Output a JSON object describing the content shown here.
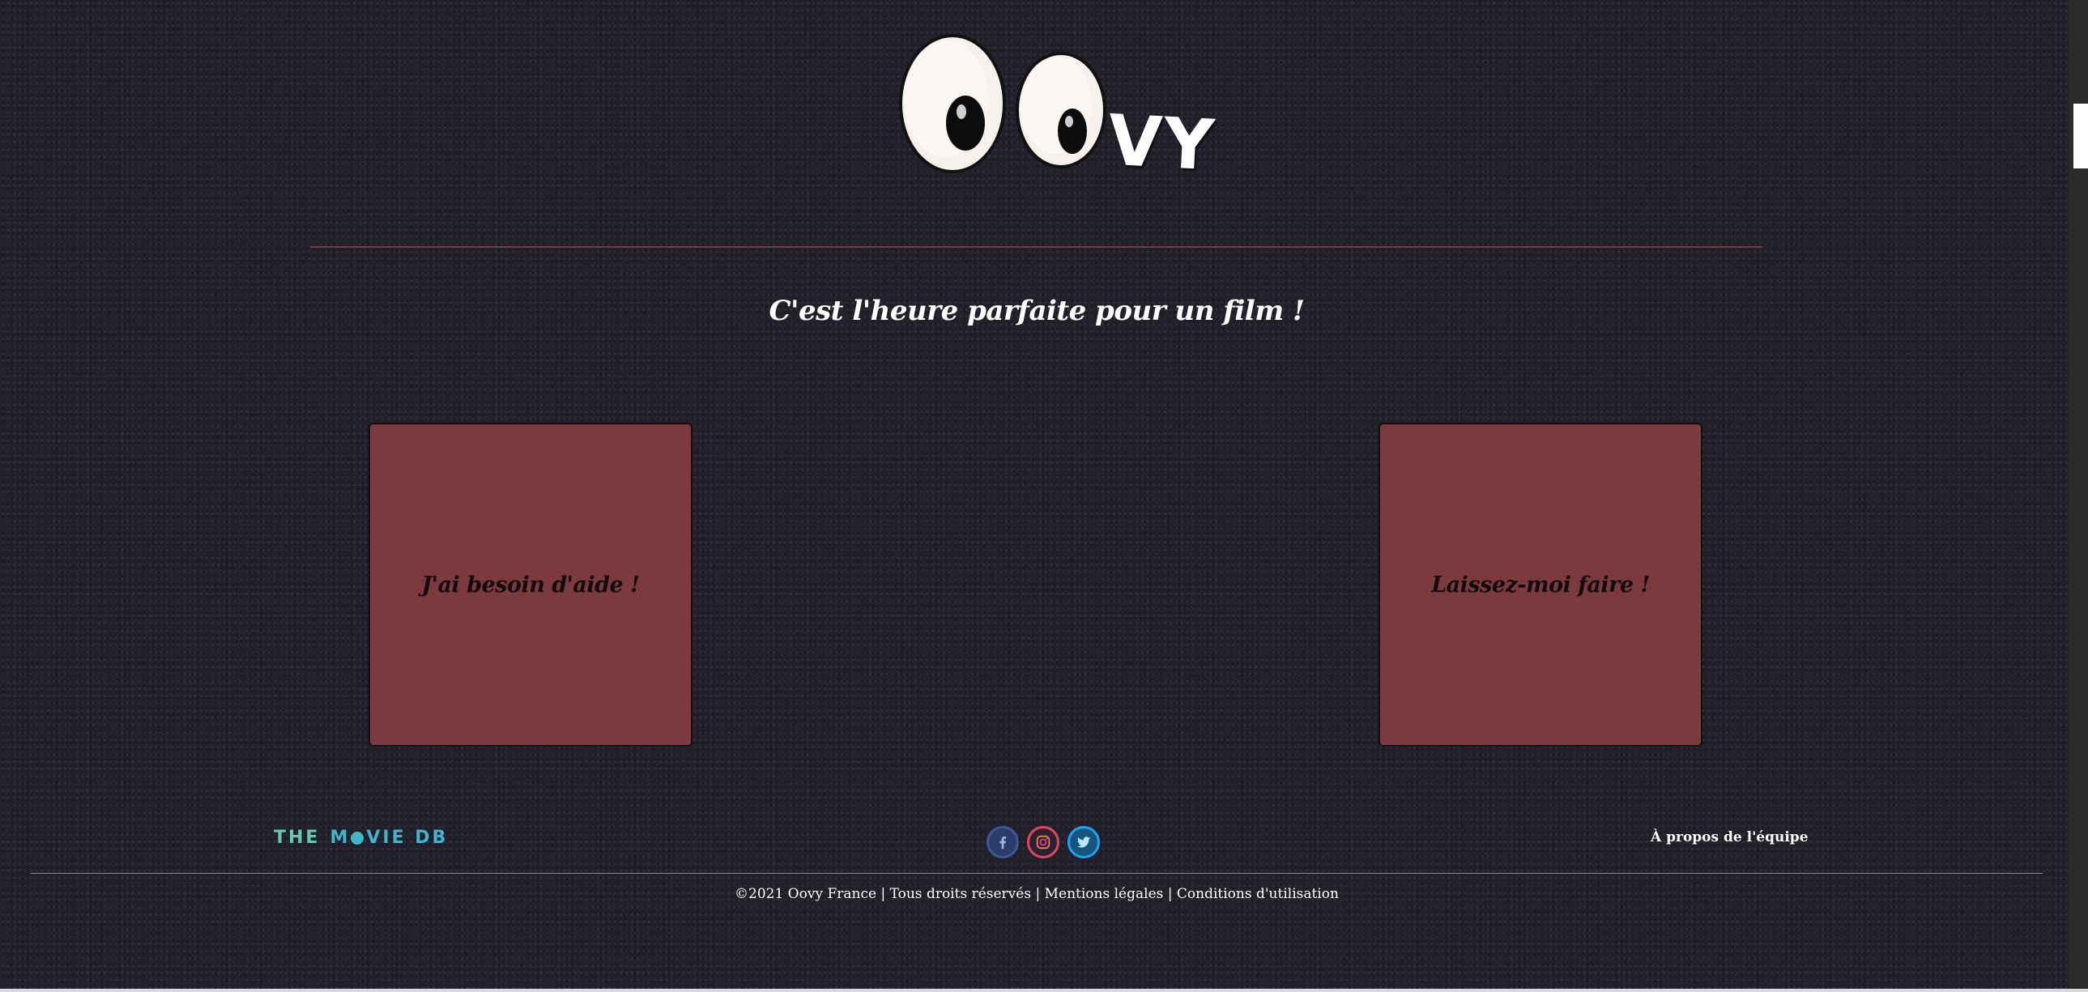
{
  "brand": {
    "logo_text": "VY",
    "logo_icon": "googly-eyes-icon"
  },
  "hero": {
    "tagline": "C'est l'heure parfaite pour un film !"
  },
  "options": [
    {
      "label": "J'ai besoin d'aide !"
    },
    {
      "label": "Laissez-moi faire !"
    }
  ],
  "footer": {
    "tmdb_logo": {
      "part1": "THE",
      "part2": "VIE DB",
      "icon": "movie-db-logo"
    },
    "social": [
      {
        "name": "Facebook",
        "icon": "facebook-icon",
        "color": "#3b5998"
      },
      {
        "name": "Instagram",
        "icon": "instagram-icon",
        "color": "#e0445f"
      },
      {
        "name": "Twitter",
        "icon": "twitter-icon",
        "color": "#1da1f2"
      }
    ],
    "about": "À propos de l'équipe",
    "copyright": "©2021 Oovy France",
    "rights": "Tous droits réservés",
    "legal_mentions": "Mentions légales",
    "terms": "Conditions d'utilisation",
    "separator": "|"
  },
  "colors": {
    "background": "#22212b",
    "card": "#7b3a3e",
    "accent_line": "#7b3b3e"
  }
}
